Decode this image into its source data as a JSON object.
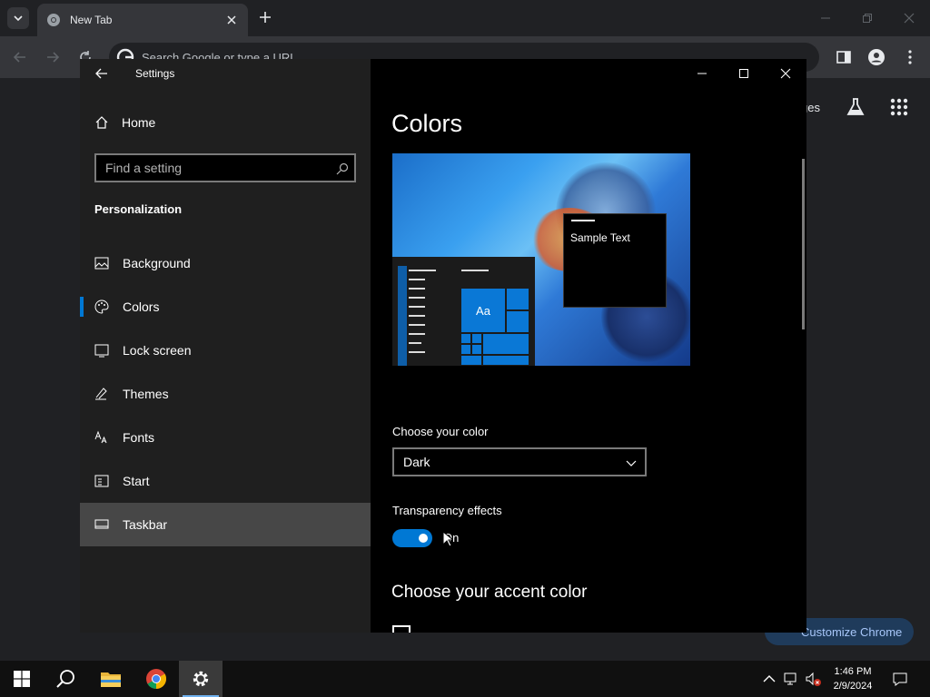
{
  "chrome": {
    "tab_title": "New Tab",
    "omnibox_placeholder": "Search Google or type a URL",
    "ntp_images_label": "ges",
    "customize_label": "Customize Chrome"
  },
  "settings": {
    "app_title": "Settings",
    "home_label": "Home",
    "search_placeholder": "Find a setting",
    "section_title": "Personalization",
    "nav_items": [
      {
        "label": "Background",
        "icon": "image-icon"
      },
      {
        "label": "Colors",
        "icon": "palette-icon"
      },
      {
        "label": "Lock screen",
        "icon": "lock-screen-icon"
      },
      {
        "label": "Themes",
        "icon": "themes-icon"
      },
      {
        "label": "Fonts",
        "icon": "fonts-icon"
      },
      {
        "label": "Start",
        "icon": "start-icon"
      },
      {
        "label": "Taskbar",
        "icon": "taskbar-icon"
      }
    ],
    "selected_item": "Colors",
    "page_title": "Colors",
    "preview_sample_text": "Sample Text",
    "preview_tile_text": "Aa",
    "choose_color_label": "Choose your color",
    "choose_color_value": "Dark",
    "transparency_label": "Transparency effects",
    "transparency_state": "On",
    "accent_title": "Choose your accent color",
    "accent_color": "#0078d4"
  },
  "taskbar": {
    "time": "1:46 PM",
    "date": "2/9/2024"
  }
}
